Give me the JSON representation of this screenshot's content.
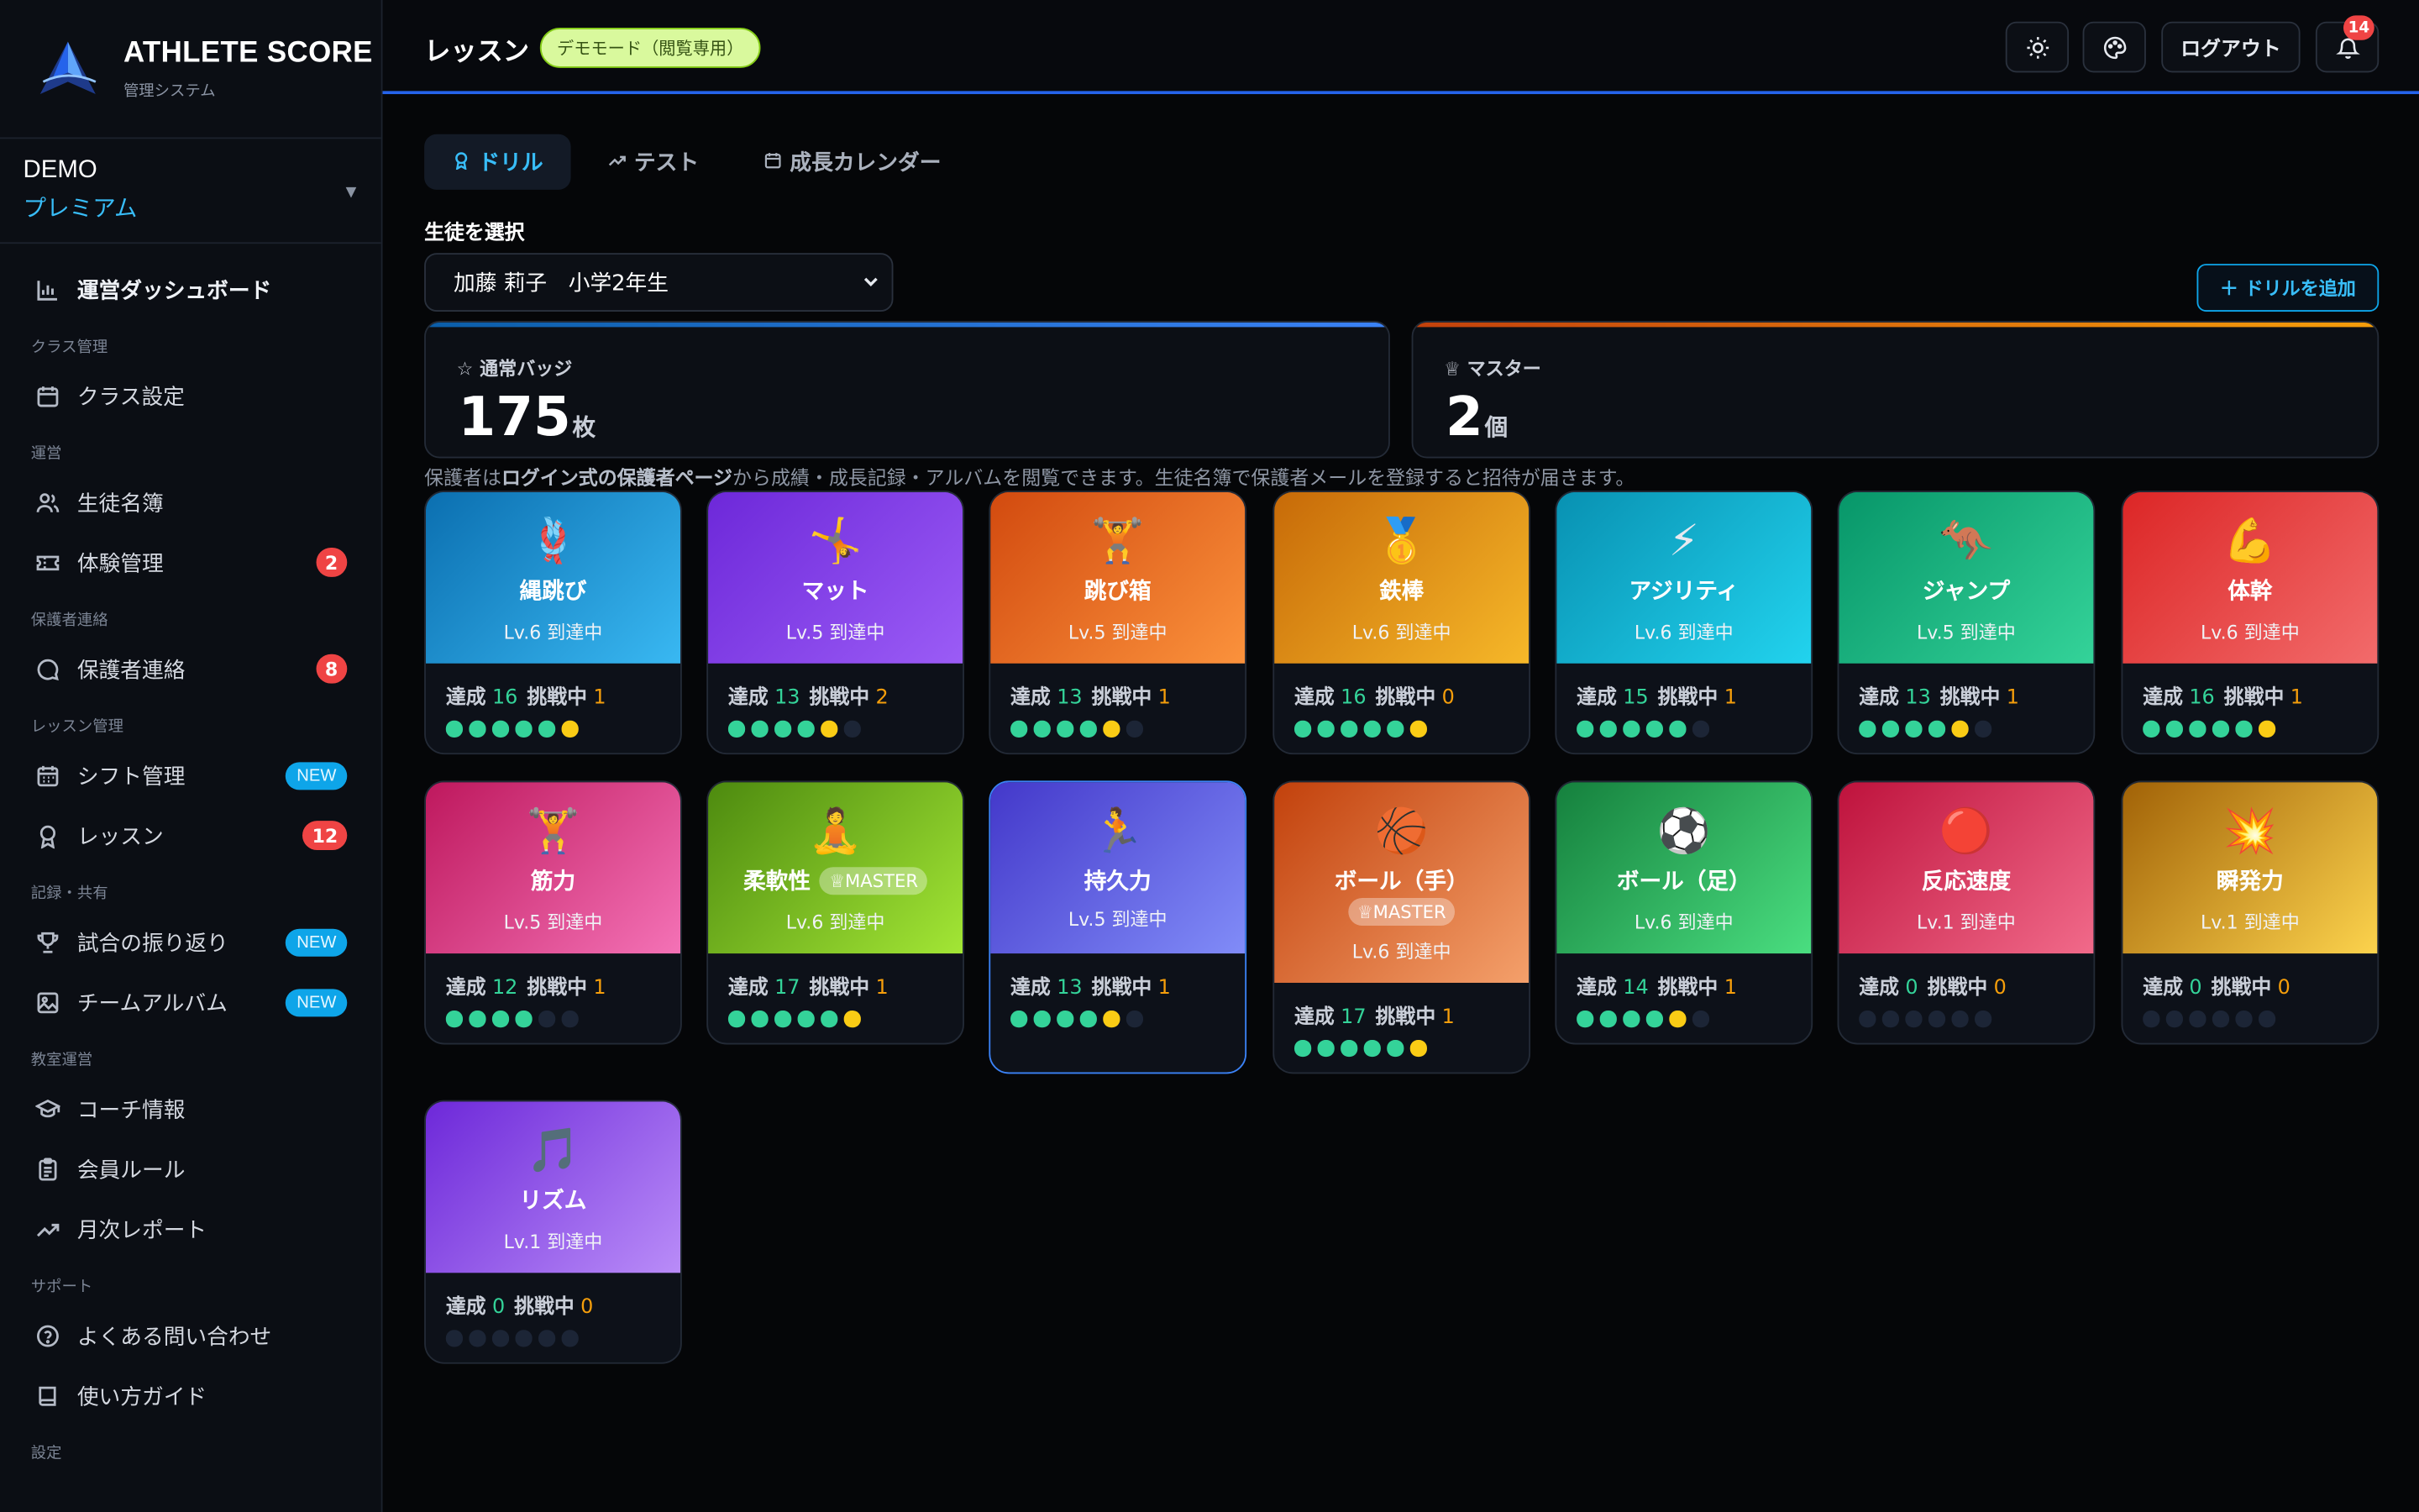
{
  "brand": {
    "name": "ATHLETE SCORE",
    "subtitle": "管理システム"
  },
  "plan": {
    "line1": "DEMO",
    "line2": "プレミアム"
  },
  "sidebar": {
    "dashboard": "運営ダッシュボード",
    "sections": {
      "class": "クラス管理",
      "operation": "運営",
      "guardian": "保護者連絡",
      "lesson": "レッスン管理",
      "record": "記録・共有",
      "school": "教室運営",
      "support": "サポート",
      "settings": "設定"
    },
    "items": {
      "class_settings": "クラス設定",
      "students": "生徒名簿",
      "trial": "体験管理",
      "trial_badge": "2",
      "guardian": "保護者連絡",
      "guardian_badge": "8",
      "shift": "シフト管理",
      "shift_badge": "NEW",
      "lesson": "レッスン",
      "lesson_badge": "12",
      "match": "試合の振り返り",
      "match_badge": "NEW",
      "album": "チームアルバム",
      "album_badge": "NEW",
      "coach": "コーチ情報",
      "rules": "会員ルール",
      "report": "月次レポート",
      "faq": "よくある問い合わせ",
      "guide": "使い方ガイド"
    }
  },
  "header": {
    "title": "レッスン",
    "demo": "デモモード（閲覧専用）",
    "logout": "ログアウト",
    "bell_count": "14"
  },
  "tabs": {
    "drill": "ドリル",
    "test": "テスト",
    "calendar": "成長カレンダー"
  },
  "student": {
    "label": "生徒を選択",
    "selected": "加藤 莉子　小学2年生"
  },
  "add_drill": "＋ ドリルを追加",
  "stats": {
    "badge_label": "通常バッジ",
    "badge_value": "175",
    "badge_unit": "枚",
    "master_label": "マスター",
    "master_value": "2",
    "master_unit": "個"
  },
  "info": {
    "pre": "保護者は",
    "bold": "ログイン式の保護者ページ",
    "post": "から成績・成長記録・アルバムを閲覧できます。生徒名簿で保護者メールを登録すると招待が届きます。"
  },
  "labels": {
    "achieved": "達成",
    "challenging": "挑戦中",
    "master": "MASTER"
  },
  "drills": [
    {
      "name": "縄跳び",
      "emoji": "🪢",
      "level": "Lv.6 到達中",
      "achieved": "16",
      "challenging": "1",
      "green": 5,
      "yellow": 1,
      "empty": 0,
      "color1": "#0b6fb0",
      "color2": "#39b8f2"
    },
    {
      "name": "マット",
      "emoji": "🤸",
      "level": "Lv.5 到達中",
      "achieved": "13",
      "challenging": "2",
      "green": 4,
      "yellow": 1,
      "empty": 1,
      "color1": "#6d28d9",
      "color2": "#9b5cf6"
    },
    {
      "name": "跳び箱",
      "emoji": "🏋️",
      "level": "Lv.5 到達中",
      "achieved": "13",
      "challenging": "1",
      "green": 4,
      "yellow": 1,
      "empty": 1,
      "color1": "#d24a0f",
      "color2": "#fb923c"
    },
    {
      "name": "鉄棒",
      "emoji": "🥇",
      "level": "Lv.6 到達中",
      "achieved": "16",
      "challenging": "0",
      "green": 5,
      "yellow": 1,
      "empty": 0,
      "color1": "#c76a08",
      "color2": "#f6b829"
    },
    {
      "name": "アジリティ",
      "emoji": "⚡",
      "level": "Lv.6 到達中",
      "achieved": "15",
      "challenging": "1",
      "green": 5,
      "yellow": 0,
      "empty": 1,
      "color1": "#0891b2",
      "color2": "#22d3ee"
    },
    {
      "name": "ジャンプ",
      "emoji": "🦘",
      "level": "Lv.5 到達中",
      "achieved": "13",
      "challenging": "1",
      "green": 4,
      "yellow": 1,
      "empty": 1,
      "color1": "#079669",
      "color2": "#34d399"
    },
    {
      "name": "体幹",
      "emoji": "💪",
      "level": "Lv.6 到達中",
      "achieved": "16",
      "challenging": "1",
      "green": 5,
      "yellow": 1,
      "empty": 0,
      "color1": "#dc2626",
      "color2": "#f26b6b"
    },
    {
      "name": "筋力",
      "emoji": "🏋️",
      "level": "Lv.5 到達中",
      "achieved": "12",
      "challenging": "1",
      "green": 4,
      "yellow": 0,
      "empty": 2,
      "color1": "#be185d",
      "color2": "#f472b6"
    },
    {
      "name": "柔軟性",
      "emoji": "🧘",
      "level": "Lv.6 到達中",
      "achieved": "17",
      "challenging": "1",
      "green": 5,
      "yellow": 1,
      "empty": 0,
      "color1": "#4d8a0f",
      "color2": "#a3e635",
      "master": "inline"
    },
    {
      "name": "持久力",
      "emoji": "🏃",
      "level": "Lv.5 到達中",
      "achieved": "13",
      "challenging": "1",
      "green": 4,
      "yellow": 1,
      "empty": 1,
      "color1": "#4338ca",
      "color2": "#818cf8",
      "active": true
    },
    {
      "name": "ボール（手）",
      "emoji": "🏀",
      "level": "Lv.6 到達中",
      "achieved": "17",
      "challenging": "1",
      "green": 5,
      "yellow": 1,
      "empty": 0,
      "color1": "#c2410c",
      "color2": "#f4a06b",
      "master": "below"
    },
    {
      "name": "ボール（足）",
      "emoji": "⚽",
      "level": "Lv.6 到達中",
      "achieved": "14",
      "challenging": "1",
      "green": 4,
      "yellow": 1,
      "empty": 1,
      "color1": "#15803d",
      "color2": "#4ade80"
    },
    {
      "name": "反応速度",
      "emoji": "🔴",
      "level": "Lv.1 到達中",
      "achieved": "0",
      "challenging": "0",
      "green": 0,
      "yellow": 0,
      "empty": 6,
      "color1": "#be123c",
      "color2": "#f16a8a"
    },
    {
      "name": "瞬発力",
      "emoji": "💥",
      "level": "Lv.1 到達中",
      "achieved": "0",
      "challenging": "0",
      "green": 0,
      "yellow": 0,
      "empty": 6,
      "color1": "#a16207",
      "color2": "#fcd34d"
    },
    {
      "name": "リズム",
      "emoji": "🎵",
      "level": "Lv.1 到達中",
      "achieved": "0",
      "challenging": "0",
      "green": 0,
      "yellow": 0,
      "empty": 6,
      "color1": "#6d28d9",
      "color2": "#b98cf8"
    }
  ]
}
